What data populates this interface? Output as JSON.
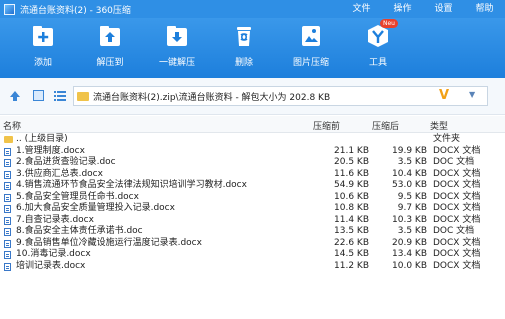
{
  "window": {
    "title": "流通台账资料(2) - 360压缩",
    "menus": [
      "文件",
      "操作",
      "设置",
      "帮助"
    ]
  },
  "toolbar": {
    "tools": [
      {
        "label": "添加",
        "icon": "add-icon"
      },
      {
        "label": "解压到",
        "icon": "extract-to-icon"
      },
      {
        "label": "一键解压",
        "icon": "one-click-extract-icon"
      },
      {
        "label": "删除",
        "icon": "delete-icon"
      },
      {
        "label": "图片压缩",
        "icon": "image-compress-icon"
      },
      {
        "label": "工具",
        "icon": "tools-icon"
      }
    ],
    "badge": "Neu"
  },
  "address": {
    "path": "流通台账资料(2).zip\\流通台账资料 - 解包大小为 202.8 KB"
  },
  "columns": {
    "name": "名称",
    "packed": "压缩前",
    "size": "压缩后",
    "type": "类型"
  },
  "files": [
    {
      "name": ".. (上级目录)",
      "packed": "",
      "size": "",
      "type": "文件夹",
      "kind": "folder"
    },
    {
      "name": "1.管理制度.docx",
      "packed": "21.1 KB",
      "size": "19.9 KB",
      "type": "DOCX 文档",
      "kind": "doc"
    },
    {
      "name": "2.食品进货查验记录.doc",
      "packed": "20.5 KB",
      "size": "3.5 KB",
      "type": "DOC 文档",
      "kind": "doc"
    },
    {
      "name": "3.供应商汇总表.docx",
      "packed": "11.6 KB",
      "size": "10.4 KB",
      "type": "DOCX 文档",
      "kind": "doc"
    },
    {
      "name": "4.销售流通环节食品安全法律法规知识培训学习教材.docx",
      "packed": "54.9 KB",
      "size": "53.0 KB",
      "type": "DOCX 文档",
      "kind": "doc"
    },
    {
      "name": "5.食品安全管理员任命书.docx",
      "packed": "10.6 KB",
      "size": "9.5 KB",
      "type": "DOCX 文档",
      "kind": "doc"
    },
    {
      "name": "6.加大食品安全质量管理投入记录.docx",
      "packed": "10.8 KB",
      "size": "9.7 KB",
      "type": "DOCX 文档",
      "kind": "doc"
    },
    {
      "name": "7.自查记录表.docx",
      "packed": "11.4 KB",
      "size": "10.3 KB",
      "type": "DOCX 文档",
      "kind": "doc"
    },
    {
      "name": "8.食品安全主体责任承诺书.doc",
      "packed": "13.5 KB",
      "size": "3.5 KB",
      "type": "DOC 文档",
      "kind": "doc"
    },
    {
      "name": "9.食品销售单位冷藏设施运行温度记录表.docx",
      "packed": "22.6 KB",
      "size": "20.9 KB",
      "type": "DOCX 文档",
      "kind": "doc"
    },
    {
      "name": "10.消毒记录.docx",
      "packed": "14.5 KB",
      "size": "13.4 KB",
      "type": "DOCX 文档",
      "kind": "doc"
    },
    {
      "name": "培训记录表.docx",
      "packed": "11.2 KB",
      "size": "10.0 KB",
      "type": "DOCX 文档",
      "kind": "doc"
    }
  ]
}
